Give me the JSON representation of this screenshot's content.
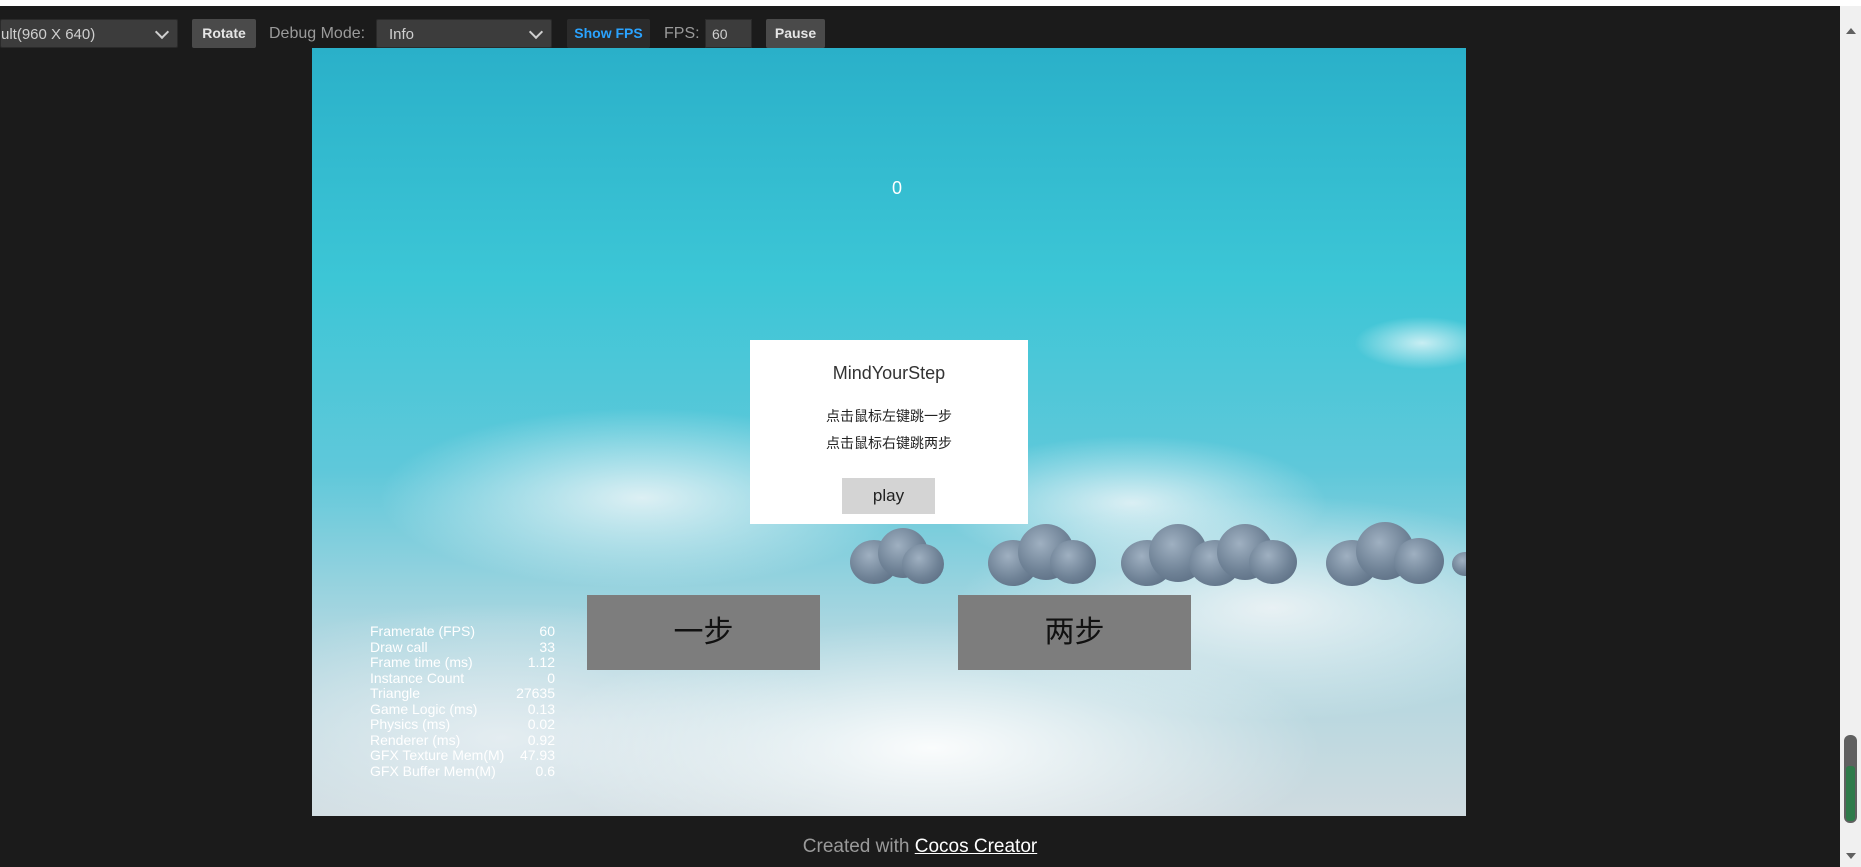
{
  "toolbar": {
    "device_select": "ult(960 X 640)",
    "rotate_label": "Rotate",
    "debug_mode_label": "Debug Mode:",
    "debug_mode_value": "Info",
    "show_fps_label": "Show FPS",
    "fps_label": "FPS:",
    "fps_value": "60",
    "pause_label": "Pause"
  },
  "game": {
    "score": "0",
    "dialog": {
      "title": "MindYourStep",
      "line1": "点击鼠标左键跳一步",
      "line2": "点击鼠标右键跳两步",
      "play_label": "play"
    },
    "one_step_label": "一步",
    "two_step_label": "两步"
  },
  "stats": [
    {
      "label": "Framerate (FPS)",
      "value": "60"
    },
    {
      "label": "Draw call",
      "value": "33"
    },
    {
      "label": "Frame time (ms)",
      "value": "1.12"
    },
    {
      "label": "Instance Count",
      "value": "0"
    },
    {
      "label": "Triangle",
      "value": "27635"
    },
    {
      "label": "Game Logic (ms)",
      "value": "0.13"
    },
    {
      "label": "Physics (ms)",
      "value": "0.02"
    },
    {
      "label": "Renderer (ms)",
      "value": "0.92"
    },
    {
      "label": "GFX Texture Mem(M)",
      "value": "47.93"
    },
    {
      "label": "GFX Buffer Mem(M)",
      "value": "0.6"
    }
  ],
  "footer": {
    "prefix": "Created with",
    "link": "Cocos Creator"
  },
  "colors": {
    "page_bg": "#1b1b1b",
    "toolbar_button": "#4a4a4a",
    "show_fps_text": "#2aa3ff",
    "step_button": "#7d7d7d",
    "sky": "#3cc6d6"
  }
}
